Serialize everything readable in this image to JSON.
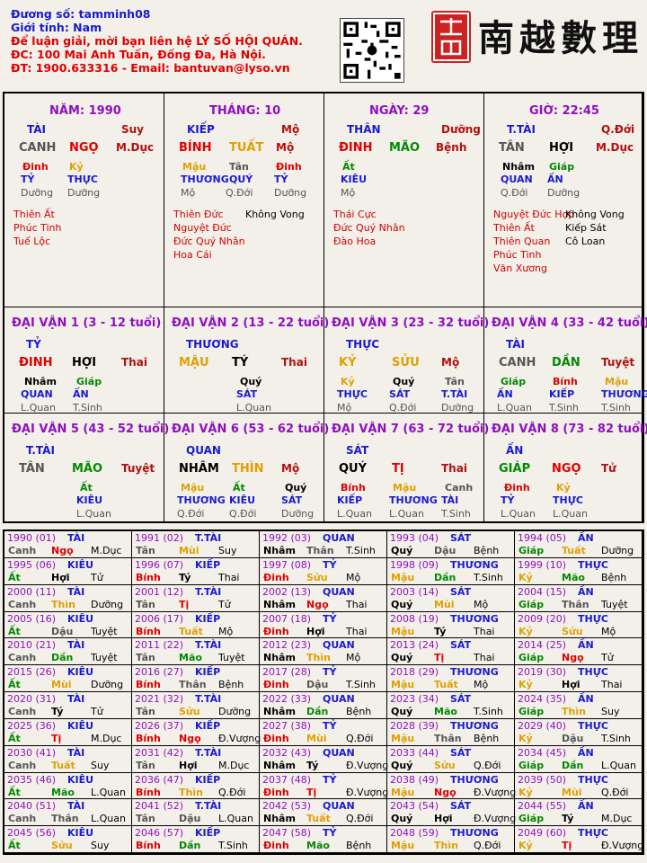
{
  "header": {
    "line1": "Đương số: tamminh08",
    "line2": "Giới tính:  Nam",
    "line3": "Để luận giải, mời bạn liên hệ LÝ SỐ HỘI QUÁN.",
    "line4": "ĐC: 100 Mai Anh Tuấn, Đống Đa, Hà Nội.",
    "line5": "ĐT: 1900.633316 - Email: bantuvan@lyso.vn"
  },
  "brand": "南越數理",
  "colors": {
    "blue": "#1a1ad0",
    "red": "#e00000",
    "green": "#008a00",
    "orange": "#e0a000",
    "purple": "#9010c0"
  },
  "pillars": [
    {
      "title": "NĂM: 1990",
      "god": "TÀI",
      "life": "Suy",
      "stem": "CANH",
      "branch": "NGỌ",
      "shen": "M.Dục",
      "hidden": [
        {
          "s": "Đinh",
          "g": "TỶ",
          "l": "Dưỡng",
          "c": "red"
        },
        {
          "s": "Kỷ",
          "g": "THỰC",
          "l": "Dưỡng",
          "c": "orange"
        }
      ],
      "stars": [
        "Thiên Ất",
        "Phúc Tinh",
        "Tuế Lộc"
      ],
      "stars2": []
    },
    {
      "title": "THÁNG: 10",
      "god": "KIẾP",
      "life": "Mộ",
      "stem": "BÍNH",
      "branch": "TUẤT",
      "shen": "Mộ",
      "hidden": [
        {
          "s": "Mậu",
          "g": "THƯƠNG",
          "l": "Mộ",
          "c": "orange"
        },
        {
          "s": "Tân",
          "g": "Q.Đới",
          "l": "",
          "c": "grey",
          "g2": "QUÝ"
        },
        {
          "s": "Đinh",
          "g": "TỶ",
          "l": "Dưỡng",
          "c": "red"
        }
      ],
      "stars": [
        "Thiên Đức",
        "Nguyệt Đức",
        "Đức Quý Nhân",
        "Hoa Cái"
      ],
      "stars2": [
        "Không Vong"
      ]
    },
    {
      "title": "NGÀY: 29",
      "god": "THÂN",
      "life": "Dưỡng",
      "stem": "ĐINH",
      "branch": "MÃO",
      "shen": "Bệnh",
      "hidden": [
        {
          "s": "Ất",
          "g": "KIÊU",
          "l": "Mộ",
          "c": "green"
        }
      ],
      "stars": [
        "Thái Cực",
        "Đức Quý Nhân",
        "Đào Hoa"
      ],
      "stars2": []
    },
    {
      "title": "GIỜ: 22:45",
      "god": "T.TÀI",
      "life": "Q.Đới",
      "stem": "TÂN",
      "branch": "HỢI",
      "shen": "M.Dục",
      "hidden": [
        {
          "s": "Nhâm",
          "g": "QUAN",
          "l": "Q.Đới",
          "c": "black"
        },
        {
          "s": "Giáp",
          "g": "ẤN",
          "l": "Dưỡng",
          "c": "green"
        }
      ],
      "stars": [
        "Nguyệt Đức Hợp",
        "Thiên Ất",
        "Thiên Quan",
        "Phúc Tinh",
        "Văn Xương"
      ],
      "stars2": [
        "Không Vong",
        "Kiếp Sát",
        "Cô Loan"
      ]
    }
  ],
  "dai_van": [
    {
      "title": "ĐẠI VẬN 1 (3 - 12 tuổi)",
      "god": "TỶ",
      "stem": "ĐINH",
      "stemc": "red",
      "branch": "HỢI",
      "branchc": "black",
      "life": "Thai",
      "hidden": [
        {
          "s": "Nhâm",
          "c": "black",
          "g": "QUAN",
          "l": "L.Quan"
        },
        {
          "s": "Giáp",
          "c": "green",
          "g": "ẤN",
          "l": "T.Sinh"
        }
      ]
    },
    {
      "title": "ĐẠI VẬN 2 (13 - 22 tuổi)",
      "god": "THƯƠNG",
      "stem": "MẬU",
      "stemc": "orange",
      "branch": "TÝ",
      "branchc": "black",
      "life": "Thai",
      "hidden": [
        {
          "s": "Quý",
          "c": "black",
          "g": "SÁT",
          "l": "L.Quan"
        }
      ]
    },
    {
      "title": "ĐẠI VẬN 3 (23 - 32 tuổi)",
      "god": "THỰC",
      "stem": "KỶ",
      "stemc": "orange",
      "branch": "SỬU",
      "branchc": "orange",
      "life": "Mộ",
      "hidden": [
        {
          "s": "Kỷ",
          "c": "orange",
          "g": "THỰC",
          "l": "Mộ"
        },
        {
          "s": "Quý",
          "c": "black",
          "g": "SÁT",
          "l": "Q.Đới"
        },
        {
          "s": "Tân",
          "c": "grey",
          "g": "T.TÀI",
          "l": "Dưỡng"
        }
      ]
    },
    {
      "title": "ĐẠI VẬN 4 (33 - 42 tuổi)",
      "god": "TÀI",
      "stem": "CANH",
      "stemc": "grey",
      "branch": "DẦN",
      "branchc": "green",
      "life": "Tuyệt",
      "hidden": [
        {
          "s": "Giáp",
          "c": "green",
          "g": "ẤN",
          "l": "L.Quan"
        },
        {
          "s": "Bính",
          "c": "red",
          "g": "KIẾP",
          "l": "T.Sinh"
        },
        {
          "s": "Mậu",
          "c": "orange",
          "g": "THƯƠNG",
          "l": "T.Sinh"
        }
      ]
    },
    {
      "title": "ĐẠI VẬN 5 (43 - 52 tuổi)",
      "god": "T.TÀI",
      "stem": "TÂN",
      "stemc": "grey",
      "branch": "MÃO",
      "branchc": "green",
      "life": "Tuyệt",
      "hidden": [
        {
          "s": "Ất",
          "c": "green",
          "g": "KIÊU",
          "l": "L.Quan"
        }
      ]
    },
    {
      "title": "ĐẠI VẬN 6 (53 - 62 tuổi)",
      "god": "QUAN",
      "stem": "NHÂM",
      "stemc": "black",
      "branch": "THÌN",
      "branchc": "orange",
      "life": "Mộ",
      "hidden": [
        {
          "s": "Mậu",
          "c": "orange",
          "g": "THƯƠNG",
          "l": "Q.Đới"
        },
        {
          "s": "Ất",
          "c": "green",
          "g": "KIÊU",
          "l": "Q.Đới"
        },
        {
          "s": "Quý",
          "c": "black",
          "g": "SÁT",
          "l": "Dưỡng"
        }
      ]
    },
    {
      "title": "ĐẠI VẬN 7 (63 - 72 tuổi)",
      "god": "SÁT",
      "stem": "QUÝ",
      "stemc": "black",
      "branch": "TỊ",
      "branchc": "red",
      "life": "Thai",
      "hidden": [
        {
          "s": "Bính",
          "c": "red",
          "g": "KIẾP",
          "l": "L.Quan"
        },
        {
          "s": "Mậu",
          "c": "orange",
          "g": "THƯƠNG",
          "l": "L.Quan"
        },
        {
          "s": "Canh",
          "c": "grey",
          "g": "TÀI",
          "l": "T.Sinh"
        }
      ]
    },
    {
      "title": "ĐẠI VẬN 8 (73 - 82 tuổi)",
      "god": "ẤN",
      "stem": "GIÁP",
      "stemc": "green",
      "branch": "NGỌ",
      "branchc": "red",
      "life": "Tử",
      "hidden": [
        {
          "s": "Đinh",
          "c": "red",
          "g": "TỶ",
          "l": "L.Quan"
        },
        {
          "s": "Kỷ",
          "c": "orange",
          "g": "THỰC",
          "l": "L.Quan"
        }
      ]
    }
  ],
  "years": [
    [
      "1990 (01)",
      "TÀI",
      "Canh",
      "grey",
      "Ngọ",
      "red",
      "M.Dục"
    ],
    [
      "1991 (02)",
      "T.TÀI",
      "Tân",
      "grey",
      "Mùi",
      "orange",
      "Suy"
    ],
    [
      "1992 (03)",
      "QUAN",
      "Nhâm",
      "black",
      "Thân",
      "grey",
      "T.Sinh"
    ],
    [
      "1993 (04)",
      "SÁT",
      "Quý",
      "black",
      "Dậu",
      "grey",
      "Bệnh"
    ],
    [
      "1994 (05)",
      "ẤN",
      "Giáp",
      "green",
      "Tuất",
      "orange",
      "Dưỡng"
    ],
    [
      "1995 (06)",
      "KIÊU",
      "Ất",
      "green",
      "Hợi",
      "black",
      "Tử"
    ],
    [
      "1996 (07)",
      "KIẾP",
      "Bính",
      "red",
      "Tý",
      "black",
      "Thai"
    ],
    [
      "1997 (08)",
      "TỶ",
      "Đinh",
      "red",
      "Sửu",
      "orange",
      "Mộ"
    ],
    [
      "1998 (09)",
      "THƯƠNG",
      "Mậu",
      "orange",
      "Dần",
      "green",
      "T.Sinh"
    ],
    [
      "1999 (10)",
      "THỰC",
      "Kỷ",
      "orange",
      "Mão",
      "green",
      "Bệnh"
    ],
    [
      "2000 (11)",
      "TÀI",
      "Canh",
      "grey",
      "Thìn",
      "orange",
      "Dưỡng"
    ],
    [
      "2001 (12)",
      "T.TÀI",
      "Tân",
      "grey",
      "Tị",
      "red",
      "Tử"
    ],
    [
      "2002 (13)",
      "QUAN",
      "Nhâm",
      "black",
      "Ngọ",
      "red",
      "Thai"
    ],
    [
      "2003 (14)",
      "SÁT",
      "Quý",
      "black",
      "Mùi",
      "orange",
      "Mộ"
    ],
    [
      "2004 (15)",
      "ẤN",
      "Giáp",
      "green",
      "Thân",
      "grey",
      "Tuyệt"
    ],
    [
      "2005 (16)",
      "KIÊU",
      "Ất",
      "green",
      "Dậu",
      "grey",
      "Tuyệt"
    ],
    [
      "2006 (17)",
      "KIẾP",
      "Bính",
      "red",
      "Tuất",
      "orange",
      "Mộ"
    ],
    [
      "2007 (18)",
      "TỶ",
      "Đinh",
      "red",
      "Hợi",
      "black",
      "Thai"
    ],
    [
      "2008 (19)",
      "THƯƠNG",
      "Mậu",
      "orange",
      "Tý",
      "black",
      "Thai"
    ],
    [
      "2009 (20)",
      "THỰC",
      "Kỷ",
      "orange",
      "Sửu",
      "orange",
      "Mộ"
    ],
    [
      "2010 (21)",
      "TÀI",
      "Canh",
      "grey",
      "Dần",
      "green",
      "Tuyệt"
    ],
    [
      "2011 (22)",
      "T.TÀI",
      "Tân",
      "grey",
      "Mão",
      "green",
      "Tuyệt"
    ],
    [
      "2012 (23)",
      "QUAN",
      "Nhâm",
      "black",
      "Thìn",
      "orange",
      "Mộ"
    ],
    [
      "2013 (24)",
      "SÁT",
      "Quý",
      "black",
      "Tị",
      "red",
      "Thai"
    ],
    [
      "2014 (25)",
      "ẤN",
      "Giáp",
      "green",
      "Ngọ",
      "red",
      "Tử"
    ],
    [
      "2015 (26)",
      "KIÊU",
      "Ất",
      "green",
      "Mùi",
      "orange",
      "Dưỡng"
    ],
    [
      "2016 (27)",
      "KIẾP",
      "Bính",
      "red",
      "Thân",
      "grey",
      "Bệnh"
    ],
    [
      "2017 (28)",
      "TỶ",
      "Đinh",
      "red",
      "Dậu",
      "grey",
      "T.Sinh"
    ],
    [
      "2018 (29)",
      "THƯƠNG",
      "Mậu",
      "orange",
      "Tuất",
      "orange",
      "Mộ"
    ],
    [
      "2019 (30)",
      "THỰC",
      "Kỷ",
      "orange",
      "Hợi",
      "black",
      "Thai"
    ],
    [
      "2020 (31)",
      "TÀI",
      "Canh",
      "grey",
      "Tý",
      "black",
      "Tử"
    ],
    [
      "2021 (32)",
      "T.TÀI",
      "Tân",
      "grey",
      "Sửu",
      "orange",
      "Dưỡng"
    ],
    [
      "2022 (33)",
      "QUAN",
      "Nhâm",
      "black",
      "Dần",
      "green",
      "Bệnh"
    ],
    [
      "2023 (34)",
      "SÁT",
      "Quý",
      "black",
      "Mão",
      "green",
      "T.Sinh"
    ],
    [
      "2024 (35)",
      "ẤN",
      "Giáp",
      "green",
      "Thìn",
      "orange",
      "Suy"
    ],
    [
      "2025 (36)",
      "KIÊU",
      "Ất",
      "green",
      "Tị",
      "red",
      "M.Dục"
    ],
    [
      "2026 (37)",
      "KIẾP",
      "Bính",
      "red",
      "Ngọ",
      "red",
      "Đ.Vượng"
    ],
    [
      "2027 (38)",
      "TỶ",
      "Đinh",
      "red",
      "Mùi",
      "orange",
      "Q.Đới"
    ],
    [
      "2028 (39)",
      "THƯƠNG",
      "Mậu",
      "orange",
      "Thân",
      "grey",
      "Bệnh"
    ],
    [
      "2029 (40)",
      "THỰC",
      "Kỷ",
      "orange",
      "Dậu",
      "grey",
      "T.Sinh"
    ],
    [
      "2030 (41)",
      "TÀI",
      "Canh",
      "grey",
      "Tuất",
      "orange",
      "Suy"
    ],
    [
      "2031 (42)",
      "T.TÀI",
      "Tân",
      "grey",
      "Hợi",
      "black",
      "M.Dục"
    ],
    [
      "2032 (43)",
      "QUAN",
      "Nhâm",
      "black",
      "Tý",
      "black",
      "Đ.Vượng"
    ],
    [
      "2033 (44)",
      "SÁT",
      "Quý",
      "black",
      "Sửu",
      "orange",
      "Q.Đới"
    ],
    [
      "2034 (45)",
      "ẤN",
      "Giáp",
      "green",
      "Dần",
      "green",
      "L.Quan"
    ],
    [
      "2035 (46)",
      "KIÊU",
      "Ất",
      "green",
      "Mão",
      "green",
      "L.Quan"
    ],
    [
      "2036 (47)",
      "KIẾP",
      "Bính",
      "red",
      "Thìn",
      "orange",
      "Q.Đới"
    ],
    [
      "2037 (48)",
      "TỶ",
      "Đinh",
      "red",
      "Tị",
      "red",
      "Đ.Vượng"
    ],
    [
      "2038 (49)",
      "THƯƠNG",
      "Mậu",
      "orange",
      "Ngọ",
      "red",
      "Đ.Vượng"
    ],
    [
      "2039 (50)",
      "THỰC",
      "Kỷ",
      "orange",
      "Mùi",
      "orange",
      "Q.Đới"
    ],
    [
      "2040 (51)",
      "TÀI",
      "Canh",
      "grey",
      "Thân",
      "grey",
      "L.Quan"
    ],
    [
      "2041 (52)",
      "T.TÀI",
      "Tân",
      "grey",
      "Dậu",
      "grey",
      "L.Quan"
    ],
    [
      "2042 (53)",
      "QUAN",
      "Nhâm",
      "black",
      "Tuất",
      "orange",
      "Q.Đới"
    ],
    [
      "2043 (54)",
      "SÁT",
      "Quý",
      "black",
      "Hợi",
      "black",
      "Đ.Vượng"
    ],
    [
      "2044 (55)",
      "ẤN",
      "Giáp",
      "green",
      "Tý",
      "black",
      "M.Dục"
    ],
    [
      "2045 (56)",
      "KIÊU",
      "Ất",
      "green",
      "Sửu",
      "orange",
      "Suy"
    ],
    [
      "2046 (57)",
      "KIẾP",
      "Bính",
      "red",
      "Dần",
      "green",
      "T.Sinh"
    ],
    [
      "2047 (58)",
      "TỶ",
      "Đinh",
      "red",
      "Mão",
      "green",
      "Bệnh"
    ],
    [
      "2048 (59)",
      "THƯƠNG",
      "Mậu",
      "orange",
      "Thìn",
      "orange",
      "Q.Đới"
    ],
    [
      "2049 (60)",
      "THỰC",
      "Kỷ",
      "orange",
      "Tị",
      "red",
      "Đ.Vượng"
    ]
  ]
}
